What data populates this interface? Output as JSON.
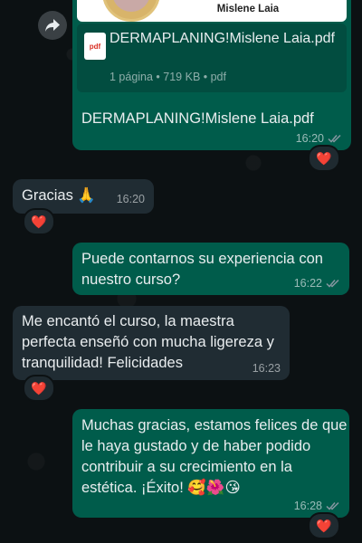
{
  "document_message": {
    "preview_title": "Mislene Laia",
    "file_name": "DERMAPLANING!Mislene Laia.pdf",
    "pdf_badge": "pdf",
    "file_info": "1 página • 719 KB • pdf",
    "caption": "DERMAPLANING!Mislene Laia.pdf",
    "time": "16:20",
    "reaction": "❤️"
  },
  "messages": [
    {
      "direction": "in",
      "text": "Gracias 🙏",
      "time": "16:20",
      "reaction": "❤️"
    },
    {
      "direction": "out",
      "text": "Puede contarnos su experiencia con nuestro curso?",
      "time": "16:22"
    },
    {
      "direction": "in",
      "text": "Me encantó el curso, la maestra perfecta enseñó con mucha ligereza y tranquilidad!  Felicidades",
      "time": "16:23",
      "reaction": "❤️"
    },
    {
      "direction": "out",
      "text": "Muchas gracias, estamos felices de que le haya gustado y de haber podido contribuir a su crecimiento en la estética. ¡Éxito! 🥰🌺😘",
      "time": "16:28",
      "reaction": "❤️"
    }
  ],
  "colors": {
    "outgoing_bubble": "#005c4b",
    "incoming_bubble": "#202c33",
    "background": "#0c1113",
    "read_ticks": "#8696a0"
  }
}
